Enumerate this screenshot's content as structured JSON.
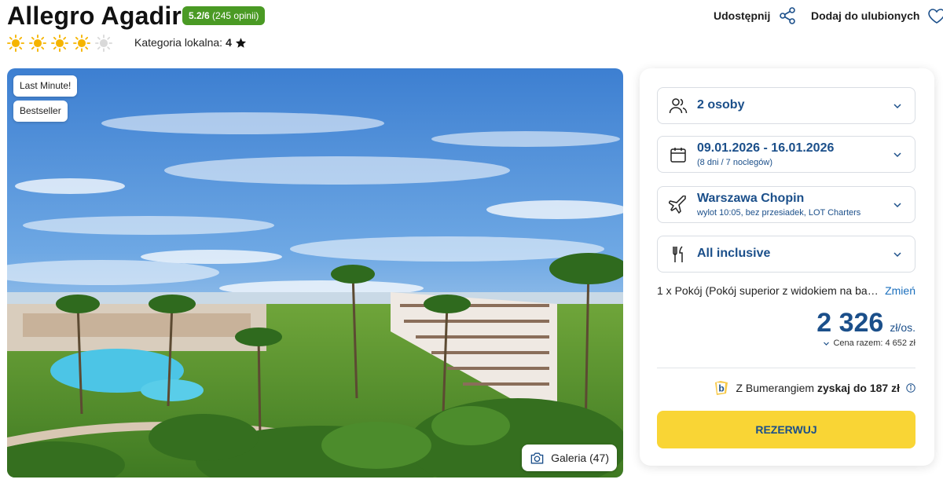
{
  "header": {
    "hotel_name": "Allegro Agadir",
    "rating_score": "5.2/6",
    "rating_count": "(245 opinii)",
    "suns_filled": 4,
    "suns_total": 5,
    "local_category_label": "Kategoria lokalna:",
    "local_category_value": "4",
    "share_label": "Udostępnij",
    "favorite_label": "Dodaj do ulubionych",
    "icons": {
      "share": "share-icon",
      "favorite": "heart-icon",
      "sun": "sun-icon",
      "star": "star-icon"
    }
  },
  "photo": {
    "tags": [
      "Last Minute!",
      "Bestseller"
    ],
    "gallery_label": "Galeria (47)",
    "gallery_icon": "camera-icon"
  },
  "booking": {
    "persons": {
      "label": "2 osoby",
      "icon": "people-icon"
    },
    "dates": {
      "label": "09.01.2026 - 16.01.2026",
      "sub": "(8 dni / 7 noclegów)",
      "icon": "calendar-icon"
    },
    "flight": {
      "label": "Warszawa Chopin",
      "sub": "wylot 10:05, bez przesiadek, LOT Charters",
      "icon": "plane-icon"
    },
    "board": {
      "label": "All inclusive",
      "icon": "cutlery-icon"
    },
    "room": {
      "text": "1 x Pokój   (Pokój superior z widokiem na bas...",
      "change_label": "Zmień"
    },
    "price": {
      "amount": "2 326",
      "unit": "zł/os.",
      "total": "Cena razem: 4 652 zł"
    },
    "bumerang": {
      "prefix": "Z Bumerangiem",
      "bold": "zyskaj do 187 zł",
      "logo": "b"
    },
    "reserve_label": "REZERWUJ",
    "colors": {
      "accent_blue": "#1b4f8a",
      "reserve_yellow": "#f9d535",
      "rating_green": "#4a9a24"
    }
  }
}
